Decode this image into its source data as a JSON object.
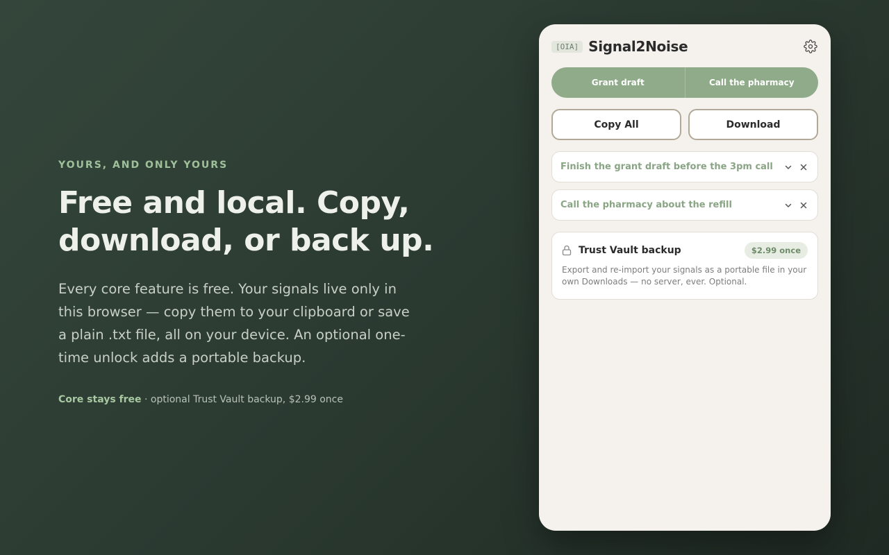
{
  "hero": {
    "eyebrow": "YOURS, AND ONLY YOURS",
    "headline": "Free and local. Copy, download, or back up.",
    "body": "Every core feature is free. Your signals live only in this browser — copy them to your clipboard or save a plain .txt file, all on your device. An optional one-time unlock adds a portable backup.",
    "footnote_strong": "Core stays free",
    "footnote_rest": " · optional Trust Vault backup, $2.99 once"
  },
  "panel": {
    "tag": "[OIA]",
    "title": "Signal2Noise",
    "settings_icon": "gear-icon",
    "segments": [
      {
        "label": "Grant draft"
      },
      {
        "label": "Call the pharmacy"
      }
    ],
    "actions": {
      "copy_label": "Copy All",
      "download_label": "Download"
    },
    "signals": [
      {
        "text": "Finish the grant draft before the 3pm call"
      },
      {
        "text": "Call the pharmacy about the refill"
      }
    ],
    "vault": {
      "title": "Trust Vault backup",
      "price": "$2.99 once",
      "description": "Export and re-import your signals as a portable file in your own Downloads — no server, ever. Optional."
    }
  },
  "colors": {
    "accent": "#8fab89",
    "eyebrow": "#9fc09a",
    "panel_bg": "#f5f2ed",
    "page_bg": "#2b3a31"
  }
}
